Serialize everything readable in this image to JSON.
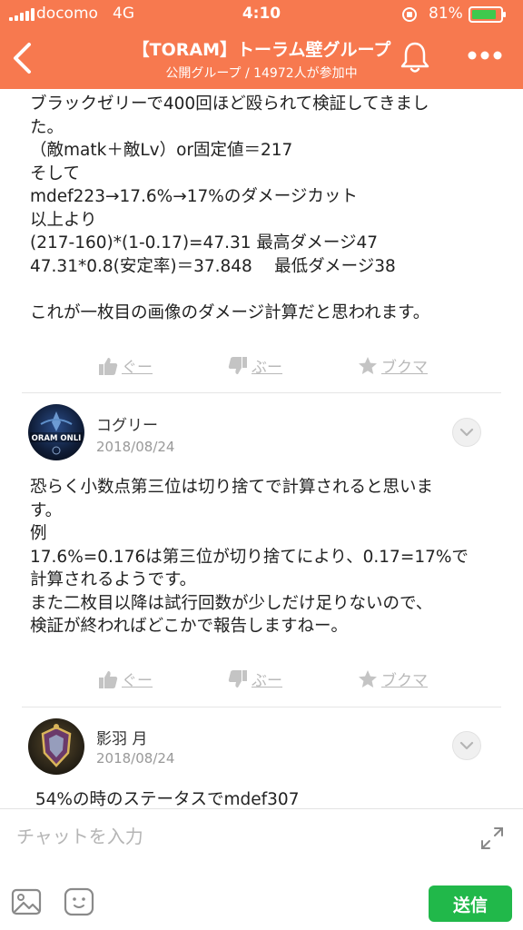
{
  "status_bar": {
    "carrier": "docomo",
    "network": "4G",
    "time": "4:10",
    "battery": "81%"
  },
  "header": {
    "title": "【TORAM】トーラム壁グループ",
    "subtitle": "公開グループ / 14972人が参加中",
    "bg_color": "#f7794f"
  },
  "posts": [
    {
      "lines": [
        "ブラックゼリーで400回ほど殴られて検証してきまし",
        "た。",
        "（敵matk＋敵Lv）or固定値＝217",
        "そして",
        "mdef223→17.6%→17%のダメージカット",
        "以上より",
        "(217-160)*(1-0.17)=47.31 最高ダメージ47",
        "47.31*0.8(安定率)＝37.848　 最低ダメージ38",
        "",
        "これが一枚目の画像のダメージ計算だと思われます。"
      ],
      "actions": {
        "good": "ぐー",
        "bad": "ぶー",
        "bookmark": "ブクマ"
      }
    },
    {
      "author": "コグリー",
      "date": "2018/08/24",
      "avatar_text": "ORAM ONLI",
      "lines": [
        "恐らく小数点第三位は切り捨てで計算されると思いま",
        "す。",
        "例",
        "17.6%=0.176は第三位が切り捨てにより、0.17=17%で",
        "計算されるようです。",
        "また二枚目以降は試行回数が少しだけ足りないので、",
        "検証が終わればどこかで報告しますねー。"
      ],
      "actions": {
        "good": "ぐー",
        "bad": "ぶー",
        "bookmark": "ブクマ"
      }
    },
    {
      "author": "影羽 月",
      "date": "2018/08/24",
      "lines": [
        " 54%の時のステータスでmdef307"
      ]
    }
  ],
  "input": {
    "placeholder": "チャットを入力",
    "send_label": "送信",
    "send_color": "#21b84a"
  }
}
